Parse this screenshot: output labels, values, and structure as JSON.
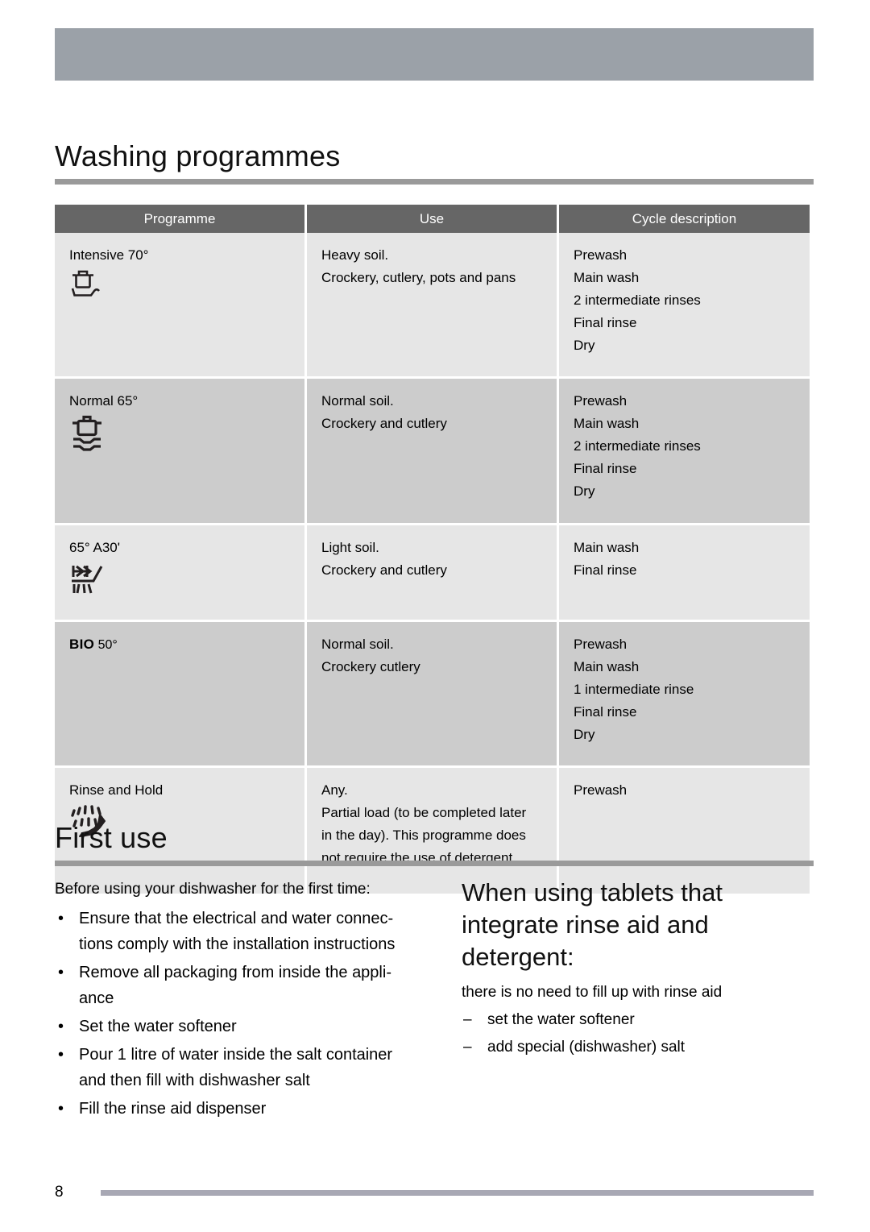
{
  "page": {
    "number": "8",
    "header_band_color": "#9ba1a8",
    "rule_color": "#9a9a9a",
    "footer_rule_color": "#a8a8b4"
  },
  "sections": {
    "washing": {
      "title": "Washing programmes"
    },
    "first_use": {
      "title": "First use"
    }
  },
  "table": {
    "columns": [
      "Programme",
      "Use",
      "Cycle description"
    ],
    "header_bg": "#666666",
    "row_bg_light": "#e6e6e6",
    "row_bg_dark": "#cccccc",
    "rows": [
      {
        "programme": "Intensive 70°",
        "icon": "pot-and-pan-icon",
        "use": [
          "Heavy soil.",
          "Crockery, cutlery, pots and pans"
        ],
        "cycle": [
          "Prewash",
          "Main wash",
          "2 intermediate rinses",
          "Final rinse",
          "Dry"
        ]
      },
      {
        "programme": "Normal 65°",
        "icon": "pot-and-plates-icon",
        "use": [
          "Normal soil.",
          "Crockery and cutlery"
        ],
        "cycle": [
          "Prewash",
          "Main wash",
          "2 intermediate rinses",
          "Final rinse",
          "Dry"
        ]
      },
      {
        "programme": "65° A30'",
        "icon": "fast-wash-icon",
        "use": [
          "Light soil.",
          "Crockery and cutlery"
        ],
        "cycle": [
          "Main wash",
          "Final rinse"
        ]
      },
      {
        "programme_bold": "BIO",
        "programme_rest": " 50°",
        "icon": "none",
        "use": [
          "Normal soil.",
          "Crockery cutlery"
        ],
        "cycle": [
          "Prewash",
          "Main wash",
          "1 intermediate rinse",
          "Final rinse",
          "Dry"
        ]
      },
      {
        "programme": "Rinse and Hold",
        "icon": "rinse-spray-icon",
        "use": [
          "Any.",
          "Partial load (to be completed later",
          "in the day). This programme does",
          "not require the use of detergent."
        ],
        "cycle": [
          "Prewash"
        ]
      }
    ]
  },
  "first_use": {
    "intro": "Before using your dishwasher for the first time:",
    "bullet_marker": "•",
    "bullets": [
      "Ensure that the electrical and water connec-\ntions comply with the installation instructions",
      "Remove all packaging from inside the appli-\nance",
      "Set the water softener",
      "Pour 1 litre of water inside the salt container\nand then fill with dishwasher salt",
      "Fill the rinse aid dispenser"
    ],
    "bullets_lines": [
      [
        "Ensure that the electrical and water connec-",
        "tions comply with the installation instructions"
      ],
      [
        "Remove all packaging from inside the appli-",
        "ance"
      ],
      [
        "Set the water softener"
      ],
      [
        "Pour 1 litre of water inside the salt container",
        "and then fill with dishwasher salt"
      ],
      [
        "Fill the rinse aid dispenser"
      ]
    ]
  },
  "tablets": {
    "heading": "When using tablets that integrate rinse aid and detergent:",
    "heading_lines": [
      "When using tablets that",
      "integrate rinse aid and",
      "detergent:"
    ],
    "intro": "there is no need to fill up with rinse aid",
    "dash_marker": "–",
    "items": [
      "set the water softener",
      "add special (dishwasher) salt"
    ]
  }
}
